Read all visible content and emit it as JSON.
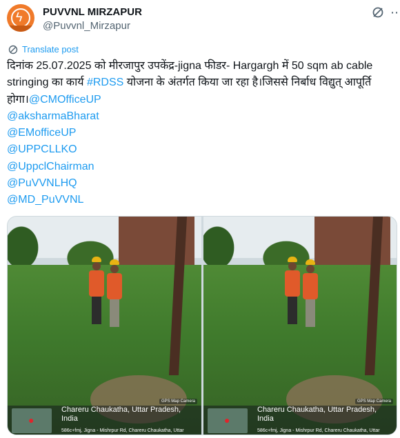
{
  "account": {
    "name": "PUVVNL MIRZAPUR",
    "handle": "@Puvvnl_Mirzapur"
  },
  "icons": {
    "avatar": "puvvnl-logo-icon",
    "grok": "grok-icon",
    "more": "more-options-icon",
    "translate": "translate-icon",
    "pin": "map-pin-icon"
  },
  "translate_label": "Translate post",
  "tweet": {
    "text_1": "दिनांक 25.07.2025  को मीरजापुर उपकेंद्र-jigna  फीडर- Hargargh में 50 sqm ab cable stringing का कार्य ",
    "hashtag": "#RDSS",
    "text_2": " योजना के अंतर्गत किया जा रहा है।जिससे निर्बाध विद्युत् आपूर्ति होगा।",
    "mentions": [
      "@CMOfficeUP",
      "@aksharmaBharat",
      "@EMofficeUP",
      "@UPPCLLKO",
      "@UppclChairman",
      "@PuVVNLHQ",
      "@MD_PuVVNL"
    ]
  },
  "photos": [
    {
      "location": "Chareru Chaukatha, Uttar Pradesh,",
      "country": "India",
      "address": "586c+fmj, Jigna - Mishrpur Rd, Chareru Chaukatha, Uttar",
      "badge": "GPS Map Camera"
    },
    {
      "location": "Chareru Chaukatha, Uttar Pradesh,",
      "country": "India",
      "address": "586c+fmj, Jigna - Mishrpur Rd, Chareru Chaukatha, Uttar",
      "badge": "GPS Map Camera"
    }
  ],
  "colors": {
    "link": "#1d9bf0",
    "text": "#0f1419",
    "muted": "#536471",
    "avatar": "#f07a2a"
  }
}
